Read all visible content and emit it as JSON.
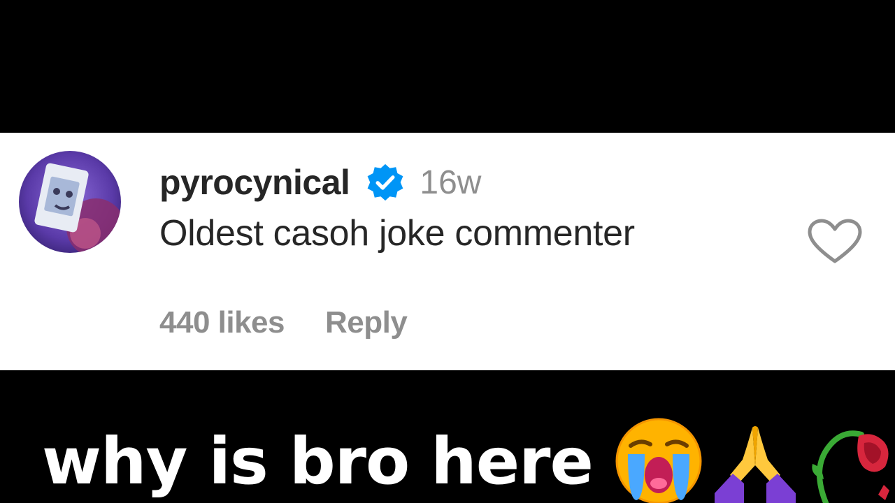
{
  "comment": {
    "username": "pyrocynical",
    "time": "16w",
    "text": "Oldest casoh joke commenter",
    "likes": "440 likes",
    "reply_label": "Reply",
    "icons": {
      "verified": "verified-badge-icon",
      "like": "heart-outline-icon",
      "avatar": "profile-avatar"
    }
  },
  "caption": {
    "text": "why is bro here",
    "emojis": [
      "loudly-crying-face-emoji",
      "folded-hands-emoji",
      "wilted-flower-emoji"
    ]
  },
  "colors": {
    "background_bars": "#000000",
    "card": "#ffffff",
    "username": "#262626",
    "secondary_text": "#8e8e8e",
    "verified_blue": "#0095f6",
    "caption": "#ffffff"
  }
}
